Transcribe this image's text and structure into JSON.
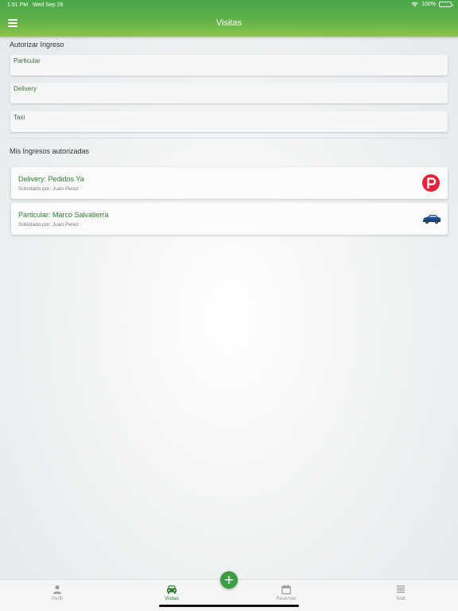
{
  "status_bar": {
    "time": "1:51 PM",
    "date": "Wed Sep 29",
    "battery": "100%"
  },
  "header": {
    "title": "Visitas",
    "menu_icon": "hamburger-menu-icon"
  },
  "authorize": {
    "title": "Autorizar Ingreso",
    "options": [
      "Particular",
      "Delivery",
      "Taxi"
    ]
  },
  "entries": {
    "title": "Mis Ingresos autorizadas",
    "items": [
      {
        "title": "Delivery: Pedidos Ya",
        "subtitle": "Solicitado por: Juan Perez",
        "icon": "pedidos-ya-logo"
      },
      {
        "title": "Particular: Marco Salvatierra",
        "subtitle": "Solicitado por: Juan Perez",
        "icon": "car-icon"
      }
    ]
  },
  "tabbar": {
    "tabs": [
      {
        "label": "Perfil",
        "icon": "person-icon"
      },
      {
        "label": "Visitas",
        "icon": "car-icon",
        "active": true
      },
      {
        "label": "Reservas",
        "icon": "calendar-icon"
      },
      {
        "label": "Wall",
        "icon": "list-icon"
      }
    ],
    "fab_label": "+"
  },
  "colors": {
    "primary_green": "#4caf50",
    "accent_green": "#2e7d32",
    "delivery_red": "#e5203a"
  }
}
